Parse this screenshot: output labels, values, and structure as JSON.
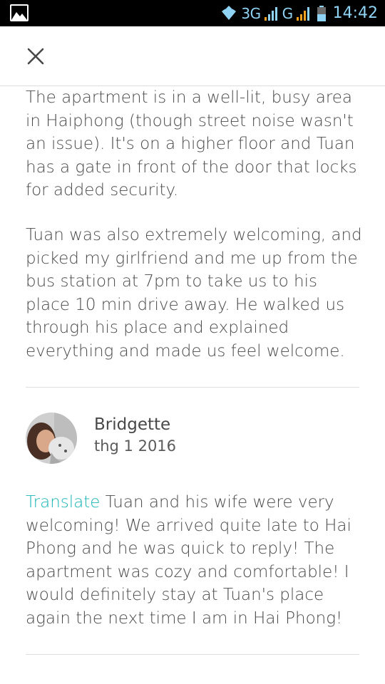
{
  "status_bar": {
    "network_1": "3G",
    "network_2": "G",
    "time": "14:42",
    "icons": [
      "gallery-icon",
      "wifi-icon",
      "signal-bars-icon",
      "signal-bars-icon",
      "battery-icon"
    ]
  },
  "header": {
    "close_icon": "close-icon"
  },
  "previous_review": {
    "paragraph_1": "The apartment is in a well-lit, busy area in Haiphong (though street noise wasn't an issue). It's on a higher floor and Tuan has a gate in front of the door that locks for added security.",
    "paragraph_2": "Tuan was also extremely welcoming, and picked my girlfriend and me up from the bus station at 7pm to take us to his place 10 min drive away. He walked us through his place and explained everything and made us feel welcome."
  },
  "review": {
    "reviewer_name": "Bridgette",
    "date": "thg 1 2016",
    "translate_label": "Translate",
    "text": "Tuan and his wife were very welcoming! We arrived quite late to Hai Phong and he was quick to reply! The apartment was cozy and comfortable! I would definitely stay at Tuan's place again the next time I am in Hai Phong!"
  },
  "colors": {
    "accent_teal": "#1ab5b5",
    "status_bar_blue": "#8fd3f4",
    "text": "#484848"
  }
}
